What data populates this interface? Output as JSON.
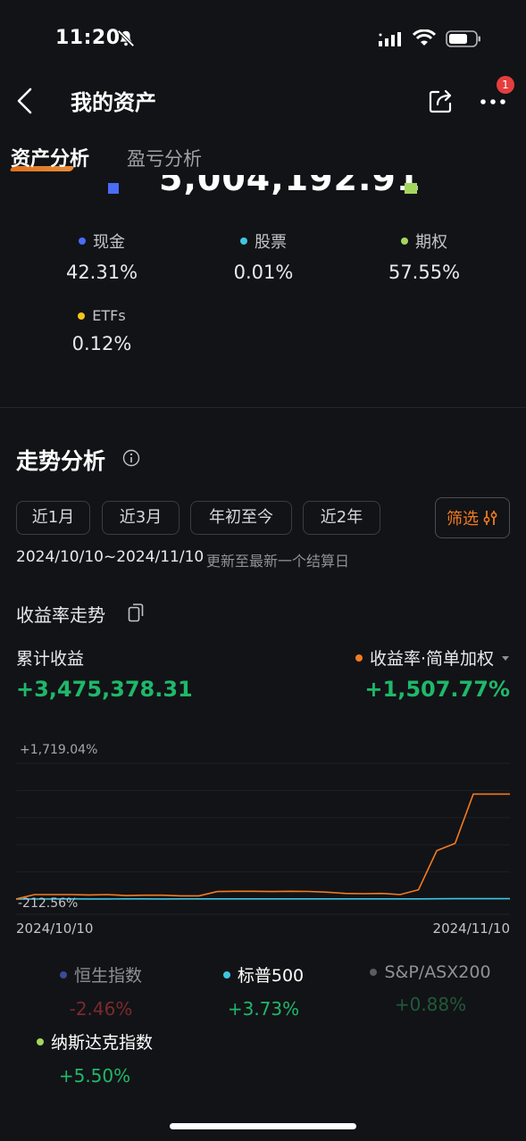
{
  "status_bar": {
    "time": "11:20"
  },
  "header": {
    "title": "我的资产",
    "badge_count": "1"
  },
  "tabs": [
    {
      "label": "资产分析",
      "active": true
    },
    {
      "label": "盈亏分析",
      "active": false
    }
  ],
  "total_value_partial": "5,004,192.91",
  "allocation": [
    {
      "label": "现金",
      "value": "42.31%",
      "color": "#4a6cf7"
    },
    {
      "label": "股票",
      "value": "0.01%",
      "color": "#3ec6e0"
    },
    {
      "label": "期权",
      "value": "57.55%",
      "color": "#a4d65e"
    },
    {
      "label": "ETFs",
      "value": "0.12%",
      "color": "#f5c518"
    }
  ],
  "trend": {
    "title": "走势分析",
    "ranges": [
      "近1月",
      "近3月",
      "年初至今",
      "近2年"
    ],
    "filter_label": "筛选",
    "date_range": "2024/10/10~2024/11/10",
    "update_note": "更新至最新一个结算日"
  },
  "return_chart": {
    "title": "收益率走势",
    "cumulative_label": "累计收益",
    "cumulative_value": "+3,475,378.31",
    "rate_label": "收益率·简单加权",
    "rate_value": "+1,507.77%",
    "y_max_label": "+1,719.04%",
    "y_min_label": "-212.56%",
    "x_start": "2024/10/10",
    "x_end": "2024/11/10"
  },
  "chart_data": {
    "type": "line",
    "ylim": [
      -212.56,
      1719.04
    ],
    "series": [
      {
        "color": "#f47b20",
        "values": [
          -212.56,
          -140,
          -140,
          -140,
          -145,
          -140,
          -155,
          -150,
          -150,
          -160,
          -160,
          -90,
          -85,
          -85,
          -90,
          -85,
          -88,
          -100,
          -120,
          -125,
          -120,
          -140,
          -60,
          580,
          700,
          1507.77,
          1507.77,
          1507.77
        ]
      },
      {
        "color": "#3ec6e0",
        "values": [
          -212.56,
          -212,
          -211,
          -210,
          -211,
          -211,
          -210,
          -210,
          -211,
          -210,
          -210,
          -209,
          -209,
          -209,
          -210,
          -209,
          -209,
          -210,
          -210,
          -210,
          -210,
          -209,
          -209,
          -208,
          -207,
          -207,
          -207,
          -207
        ]
      }
    ]
  },
  "benchmarks": [
    {
      "label": "恒生指数",
      "value": "-2.46%",
      "dot": "#3b4a9a",
      "label_color": "#8e9198",
      "value_color": "#7a2a2e"
    },
    {
      "label": "标普500",
      "value": "+3.73%",
      "dot": "#3ec6e0",
      "label_color": "#ffffff",
      "value_color": "#1fb86a"
    },
    {
      "label": "S&P/ASX200",
      "value": "+0.88%",
      "dot": "#5a5d63",
      "label_color": "#8e9198",
      "value_color": "#1f5a3a"
    },
    {
      "label": "纳斯达克指数",
      "value": "+5.50%",
      "dot": "#a4d65e",
      "label_color": "#ffffff",
      "value_color": "#1fb86a"
    }
  ]
}
